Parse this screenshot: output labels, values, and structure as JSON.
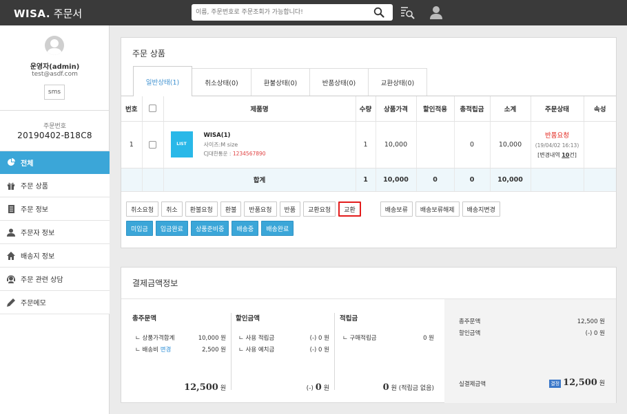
{
  "app": {
    "brand_bold": "WISA.",
    "brand_title": "주문서"
  },
  "search": {
    "placeholder": "이름, 주문번호로 주문조회가 가능합니다!"
  },
  "sidebar": {
    "user_name": "운영자(admin)",
    "user_email": "test@asdf.com",
    "sms_label": "sms",
    "order_label": "주문번호",
    "order_number": "20190402-B18C8",
    "items": [
      {
        "label": "전체",
        "icon": "pie-chart-icon"
      },
      {
        "label": "주문 상품",
        "icon": "gift-icon"
      },
      {
        "label": "주문 정보",
        "icon": "document-icon"
      },
      {
        "label": "주문자 정보",
        "icon": "person-icon"
      },
      {
        "label": "배송지 정보",
        "icon": "home-icon"
      },
      {
        "label": "주문 관련 상담",
        "icon": "headset-icon"
      },
      {
        "label": "주문메모",
        "icon": "pencil-icon"
      }
    ]
  },
  "products": {
    "title": "주문 상품",
    "tabs": [
      "일반상태(1)",
      "취소상태(0)",
      "환불상태(0)",
      "반품상태(0)",
      "교환상태(0)"
    ],
    "columns": [
      "번호",
      "",
      "제품명",
      "수량",
      "상품가격",
      "할인적용",
      "총적립금",
      "소계",
      "주문상태",
      "속성"
    ],
    "row": {
      "no": "1",
      "thumb_label": "LIST",
      "name": "WISA(1)",
      "option": "사이즈:M size",
      "ship_label": "CJ대한통운 : ",
      "ship_number": "1234567890",
      "qty": "1",
      "price": "10,000",
      "discount": "",
      "points": "0",
      "subtotal": "10,000",
      "status": "반품요청",
      "status_date": "(19/04/02 16:13)",
      "status_change_prefix": "[변경내역 ",
      "status_change_count": "10",
      "status_change_suffix": "건]"
    },
    "total": {
      "label": "합계",
      "qty": "1",
      "price": "10,000",
      "discount": "0",
      "points": "0",
      "subtotal": "10,000"
    },
    "action_buttons": [
      "취소요청",
      "취소",
      "환불요청",
      "환불",
      "반품요청",
      "반품",
      "교환요청",
      "교환"
    ],
    "ship_buttons": [
      "배송보류",
      "배송보류해제",
      "배송지변경"
    ],
    "status_buttons": [
      "미입금",
      "입금완료",
      "상품준비중",
      "배송중",
      "배송완료"
    ]
  },
  "payment": {
    "title": "결제금액정보",
    "order_amount": {
      "title": "총주문액",
      "rows": [
        {
          "label": "ㄴ 상품가격합계",
          "value": "10,000 원"
        },
        {
          "label": "ㄴ 배송비 ",
          "link": "변경",
          "value": "2,500 원"
        }
      ],
      "total": "12,500",
      "unit": " 원"
    },
    "discount": {
      "title": "할인금액",
      "rows": [
        {
          "label": "ㄴ 사용 적립금",
          "value": "(-) 0 원"
        },
        {
          "label": "ㄴ 사용 예치금",
          "value": "(-) 0 원"
        }
      ],
      "total_prefix": "(-) ",
      "total": "0",
      "unit": " 원"
    },
    "points": {
      "title": "적립금",
      "rows": [
        {
          "label": "ㄴ 구매적립금",
          "value": "0 원"
        }
      ],
      "total": "0",
      "unit": " 원 (적립금 없음)"
    },
    "summary": {
      "order_label": "총주문액",
      "order_value": "12,500 원",
      "discount_label": "할인금액",
      "discount_value": "(-) 0 원",
      "final_label": "실결제금액",
      "final_badge": "결정",
      "final_value": "12,500",
      "final_unit": " 원"
    }
  }
}
